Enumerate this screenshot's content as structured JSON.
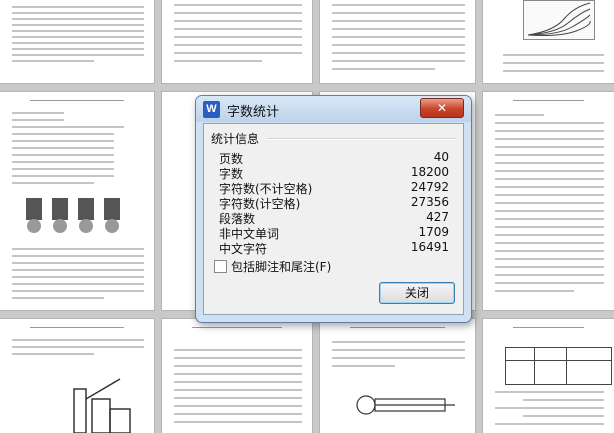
{
  "dialog": {
    "title": "字数统计",
    "app_icon": "W",
    "close_label": "✕",
    "group_label": "统计信息",
    "stats": [
      {
        "label": "页数",
        "value": "40"
      },
      {
        "label": "字数",
        "value": "18200"
      },
      {
        "label": "字符数(不计空格)",
        "value": "24792"
      },
      {
        "label": "字符数(计空格)",
        "value": "27356"
      },
      {
        "label": "段落数",
        "value": "427"
      },
      {
        "label": "非中文单词",
        "value": "1709"
      },
      {
        "label": "中文字符",
        "value": "16491"
      }
    ],
    "include_footnotes_label": "包括脚注和尾注(F)",
    "include_footnotes_checked": false,
    "close_button": "关闭"
  },
  "colors": {
    "desktop_bg": "#c9c9c9",
    "dialog_frame": "#cfe0f2",
    "close_red": "#c9452b",
    "accent_blue": "#2a5fc0"
  }
}
